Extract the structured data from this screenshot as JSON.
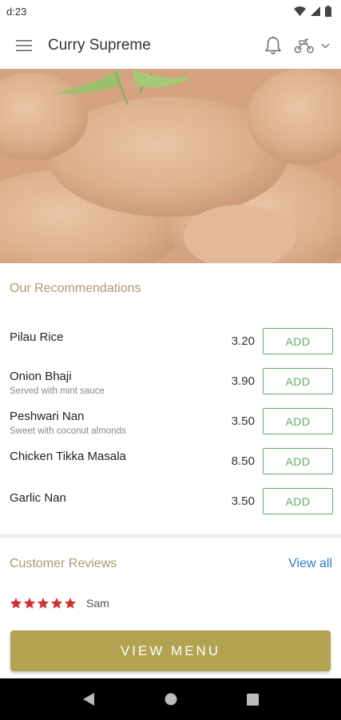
{
  "status_bar": {
    "time": "d:23"
  },
  "app_bar": {
    "title": "Curry Supreme"
  },
  "recommendations": {
    "title": "Our Recommendations",
    "items": [
      {
        "name": "Pilau Rice",
        "description": "",
        "price": "3.20",
        "button": "ADD"
      },
      {
        "name": "Onion Bhaji",
        "description": "Served with mint sauce",
        "price": "3.90",
        "button": "ADD"
      },
      {
        "name": "Peshwari Nan",
        "description": "Sweet with coconut almonds",
        "price": "3.50",
        "button": "ADD"
      },
      {
        "name": "Chicken Tikka Masala",
        "description": "",
        "price": "8.50",
        "button": "ADD"
      },
      {
        "name": "Garlic Nan",
        "description": "",
        "price": "3.50",
        "button": "ADD"
      }
    ]
  },
  "reviews": {
    "title": "Customer Reviews",
    "view_all": "View all",
    "items": [
      {
        "rating": 5,
        "author": "Sam"
      }
    ]
  },
  "footer": {
    "view_menu": "VIEW MENU"
  },
  "colors": {
    "accent_gold": "#b3a350",
    "section_title": "#a79b6f",
    "add_green": "#5cab6b",
    "link_blue": "#2f7dbf",
    "star_red": "#d32f2f"
  },
  "icons": {
    "menu": "hamburger-icon",
    "notifications": "bell-icon",
    "delivery_mode": "scooter-icon",
    "dropdown": "chevron-down-icon",
    "star": "star-icon"
  }
}
